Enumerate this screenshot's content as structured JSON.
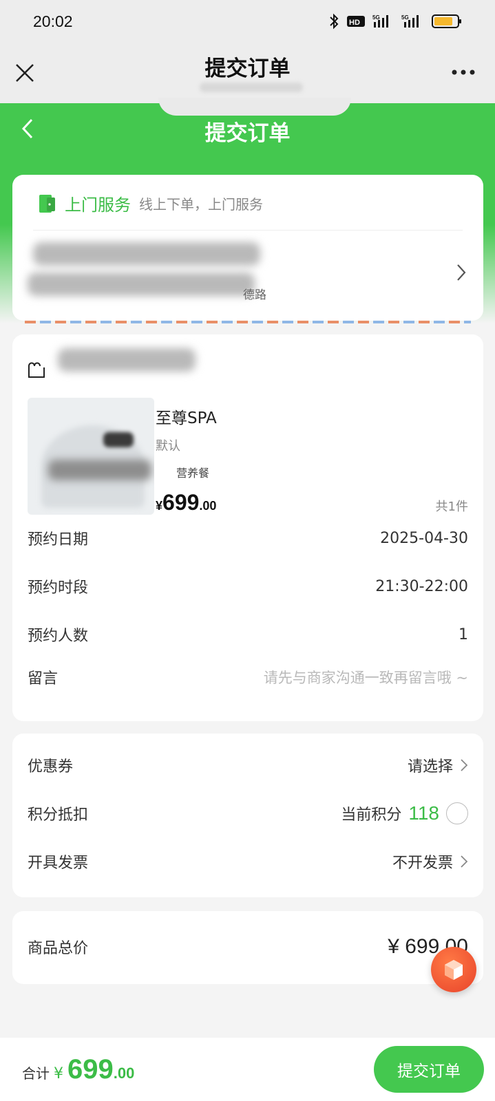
{
  "status_bar": {
    "time": "20:02"
  },
  "mp_header": {
    "title": "提交订单"
  },
  "page": {
    "title": "提交订单"
  },
  "service": {
    "title": "上门服务",
    "desc": "线上下单，上门服务",
    "address_tail": "德路"
  },
  "product": {
    "name": "至尊SPA",
    "spec": "默认",
    "package": "营养餐",
    "price_currency": "¥",
    "price_int": "699",
    "price_dec": ".00",
    "count": "共1件"
  },
  "booking": {
    "date_label": "预约日期",
    "date_value": "2025-04-30",
    "time_label": "预约时段",
    "time_value": "21:30-22:00",
    "people_label": "预约人数",
    "people_value": "1",
    "note_label": "留言",
    "note_placeholder": "请先与商家沟通一致再留言哦 ~"
  },
  "options": {
    "coupon_label": "优惠券",
    "coupon_value": "请选择",
    "points_label": "积分抵扣",
    "points_prefix": "当前积分",
    "points_value": "118",
    "invoice_label": "开具发票",
    "invoice_value": "不开发票"
  },
  "total": {
    "label": "商品总价",
    "value": "¥ 699.00"
  },
  "bottom": {
    "sum_label": "合计",
    "sum_currency": "¥",
    "sum_int": "699",
    "sum_dec": ".00",
    "submit_label": "提交订单"
  },
  "colors": {
    "brand_green": "#44c84f",
    "accent_text_green": "#3cbc47",
    "float_button": "#e8432a"
  }
}
